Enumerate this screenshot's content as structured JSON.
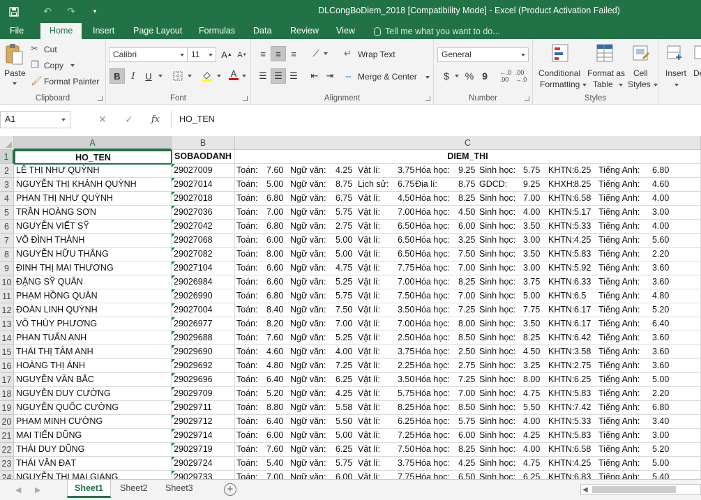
{
  "window": {
    "title": "DLCongBoDiem_2018  [Compatibility Mode] - Excel (Product Activation Failed)"
  },
  "qat": {
    "save_icon": "save-icon",
    "undo_icon": "undo-icon",
    "redo_icon": "redo-icon",
    "customize_icon": "customize-icon"
  },
  "tabs": [
    "File",
    "Home",
    "Insert",
    "Page Layout",
    "Formulas",
    "Data",
    "Review",
    "View"
  ],
  "tell_me": "Tell me what you want to do...",
  "ribbon": {
    "clipboard": {
      "label": "Clipboard",
      "paste": "Paste",
      "cut": "Cut",
      "copy": "Copy",
      "format_painter": "Format Painter"
    },
    "font": {
      "label": "Font",
      "name": "Calibri",
      "size": "11",
      "bold": "B",
      "italic": "I",
      "underline": "U"
    },
    "alignment": {
      "label": "Alignment",
      "wrap_text": "Wrap Text",
      "merge_center": "Merge & Center"
    },
    "number": {
      "label": "Number",
      "format": "General",
      "currency": "$",
      "percent": "%",
      "comma": "9"
    },
    "styles": {
      "label": "Styles",
      "conditional_1": "Conditional",
      "conditional_2": "Formatting",
      "format_table_1": "Format as",
      "format_table_2": "Table",
      "cell_styles_1": "Cell",
      "cell_styles_2": "Styles"
    },
    "cells": {
      "insert": "Insert",
      "delete_partial": "De"
    }
  },
  "formula_bar": {
    "name_box": "A1",
    "fx": "fx",
    "content": "HO_TEN"
  },
  "columns": [
    "A",
    "B",
    "C"
  ],
  "header_row": {
    "row": "1",
    "a": "HO_TEN",
    "b": "SOBAODANH",
    "c": "DIEM_THI"
  },
  "rows": [
    {
      "row": "2",
      "name": "LÊ THỊ NHƯ QUỲNH",
      "sbd": "29027009",
      "scores": [
        [
          "Toán:",
          "7.60"
        ],
        [
          "Ngữ văn:",
          "4.25"
        ],
        [
          "Vật lí:",
          "3.75"
        ],
        [
          "Hóa học:",
          "9.25"
        ],
        [
          "Sinh học:",
          "5.75"
        ],
        [
          "KHTN:",
          "6.25"
        ],
        [
          "Tiếng Anh:",
          "6.80"
        ]
      ]
    },
    {
      "row": "3",
      "name": "NGUYỄN THỊ KHÁNH QUỲNH",
      "sbd": "29027014",
      "scores": [
        [
          "Toán:",
          "5.00"
        ],
        [
          "Ngữ văn:",
          "8.75"
        ],
        [
          "Lịch sử:",
          "6.75"
        ],
        [
          "Địa lí:",
          "8.75"
        ],
        [
          "GDCD:",
          "9.25"
        ],
        [
          "KHXH:",
          "8.25"
        ],
        [
          "Tiếng Anh:",
          "4.60"
        ]
      ]
    },
    {
      "row": "4",
      "name": "PHAN THỊ NHƯ QUỲNH",
      "sbd": "29027018",
      "scores": [
        [
          "Toán:",
          "6.80"
        ],
        [
          "Ngữ văn:",
          "6.75"
        ],
        [
          "Vật lí:",
          "4.50"
        ],
        [
          "Hóa học:",
          "8.25"
        ],
        [
          "Sinh học:",
          "7.00"
        ],
        [
          "KHTN:",
          "6.58"
        ],
        [
          "Tiếng Anh:",
          "4.00"
        ]
      ]
    },
    {
      "row": "5",
      "name": "TRẦN HOÀNG SƠN",
      "sbd": "29027036",
      "scores": [
        [
          "Toán:",
          "7.00"
        ],
        [
          "Ngữ văn:",
          "5.75"
        ],
        [
          "Vật lí:",
          "7.00"
        ],
        [
          "Hóa học:",
          "4.50"
        ],
        [
          "Sinh học:",
          "4.00"
        ],
        [
          "KHTN:",
          "5.17"
        ],
        [
          "Tiếng Anh:",
          "3.00"
        ]
      ]
    },
    {
      "row": "6",
      "name": "NGUYỄN VIẾT SỸ",
      "sbd": "29027042",
      "scores": [
        [
          "Toán:",
          "6.80"
        ],
        [
          "Ngữ văn:",
          "2.75"
        ],
        [
          "Vật lí:",
          "6.50"
        ],
        [
          "Hóa học:",
          "6.00"
        ],
        [
          "Sinh học:",
          "3.50"
        ],
        [
          "KHTN:",
          "5.33"
        ],
        [
          "Tiếng Anh:",
          "4.00"
        ]
      ]
    },
    {
      "row": "7",
      "name": "VÕ ĐÌNH THÀNH",
      "sbd": "29027068",
      "scores": [
        [
          "Toán:",
          "6.00"
        ],
        [
          "Ngữ văn:",
          "5.00"
        ],
        [
          "Vật lí:",
          "6.50"
        ],
        [
          "Hóa học:",
          "3.25"
        ],
        [
          "Sinh học:",
          "3.00"
        ],
        [
          "KHTN:",
          "4.25"
        ],
        [
          "Tiếng Anh:",
          "5.60"
        ]
      ]
    },
    {
      "row": "8",
      "name": "NGUYỄN HỮU THẮNG",
      "sbd": "29027082",
      "scores": [
        [
          "Toán:",
          "8.00"
        ],
        [
          "Ngữ văn:",
          "5.00"
        ],
        [
          "Vật lí:",
          "6.50"
        ],
        [
          "Hóa học:",
          "7.50"
        ],
        [
          "Sinh học:",
          "3.50"
        ],
        [
          "KHTN:",
          "5.83"
        ],
        [
          "Tiếng Anh:",
          "2.20"
        ]
      ]
    },
    {
      "row": "9",
      "name": "ĐINH THỊ MAI THƯƠNG",
      "sbd": "29027104",
      "scores": [
        [
          "Toán:",
          "6.60"
        ],
        [
          "Ngữ văn:",
          "4.75"
        ],
        [
          "Vật lí:",
          "7.75"
        ],
        [
          "Hóa học:",
          "7.00"
        ],
        [
          "Sinh học:",
          "3.00"
        ],
        [
          "KHTN:",
          "5.92"
        ],
        [
          "Tiếng Anh:",
          "3.60"
        ]
      ]
    },
    {
      "row": "10",
      "name": "ĐẶNG SỸ QUÂN",
      "sbd": "29026984",
      "scores": [
        [
          "Toán:",
          "6.60"
        ],
        [
          "Ngữ văn:",
          "5.25"
        ],
        [
          "Vật lí:",
          "7.00"
        ],
        [
          "Hóa học:",
          "8.25"
        ],
        [
          "Sinh học:",
          "3.75"
        ],
        [
          "KHTN:",
          "6.33"
        ],
        [
          "Tiếng Anh:",
          "3.60"
        ]
      ]
    },
    {
      "row": "11",
      "name": "PHẠM HỒNG QUÂN",
      "sbd": "29026990",
      "scores": [
        [
          "Toán:",
          "6.80"
        ],
        [
          "Ngữ văn:",
          "5.75"
        ],
        [
          "Vật lí:",
          "7.50"
        ],
        [
          "Hóa học:",
          "7.00"
        ],
        [
          "Sinh học:",
          "5.00"
        ],
        [
          "KHTN:",
          "6.5"
        ],
        [
          "Tiếng Anh:",
          "4.80"
        ]
      ]
    },
    {
      "row": "12",
      "name": "ĐOÀN LINH QUỲNH",
      "sbd": "29027004",
      "scores": [
        [
          "Toán:",
          "8.40"
        ],
        [
          "Ngữ văn:",
          "7.50"
        ],
        [
          "Vật lí:",
          "3.50"
        ],
        [
          "Hóa học:",
          "7.25"
        ],
        [
          "Sinh học:",
          "7.75"
        ],
        [
          "KHTN:",
          "6.17"
        ],
        [
          "Tiếng Anh:",
          "5.20"
        ]
      ]
    },
    {
      "row": "13",
      "name": "VÕ THÙY PHƯƠNG",
      "sbd": "29026977",
      "scores": [
        [
          "Toán:",
          "8.20"
        ],
        [
          "Ngữ văn:",
          "7.00"
        ],
        [
          "Vật lí:",
          "7.00"
        ],
        [
          "Hóa học:",
          "8.00"
        ],
        [
          "Sinh học:",
          "3.50"
        ],
        [
          "KHTN:",
          "6.17"
        ],
        [
          "Tiếng Anh:",
          "6.40"
        ]
      ]
    },
    {
      "row": "14",
      "name": "PHAN TUẤN ANH",
      "sbd": "29029688",
      "scores": [
        [
          "Toán:",
          "7.60"
        ],
        [
          "Ngữ văn:",
          "5.25"
        ],
        [
          "Vật lí:",
          "2.50"
        ],
        [
          "Hóa học:",
          "8.50"
        ],
        [
          "Sinh học:",
          "8.25"
        ],
        [
          "KHTN:",
          "6.42"
        ],
        [
          "Tiếng Anh:",
          "3.60"
        ]
      ]
    },
    {
      "row": "15",
      "name": "THÁI THỊ TÂM ANH",
      "sbd": "29029690",
      "scores": [
        [
          "Toán:",
          "4.60"
        ],
        [
          "Ngữ văn:",
          "4.00"
        ],
        [
          "Vật lí:",
          "3.75"
        ],
        [
          "Hóa học:",
          "2.50"
        ],
        [
          "Sinh học:",
          "4.50"
        ],
        [
          "KHTN:",
          "3.58"
        ],
        [
          "Tiếng Anh:",
          "3.60"
        ]
      ]
    },
    {
      "row": "16",
      "name": "HOÀNG THỊ ÁNH",
      "sbd": "29029692",
      "scores": [
        [
          "Toán:",
          "4.80"
        ],
        [
          "Ngữ văn:",
          "7.25"
        ],
        [
          "Vật lí:",
          "2.25"
        ],
        [
          "Hóa học:",
          "2.75"
        ],
        [
          "Sinh học:",
          "3.25"
        ],
        [
          "KHTN:",
          "2.75"
        ],
        [
          "Tiếng Anh:",
          "3.60"
        ]
      ]
    },
    {
      "row": "17",
      "name": "NGUYỄN VĂN BẮC",
      "sbd": "29029696",
      "scores": [
        [
          "Toán:",
          "6.40"
        ],
        [
          "Ngữ văn:",
          "6.25"
        ],
        [
          "Vật lí:",
          "3.50"
        ],
        [
          "Hóa học:",
          "7.25"
        ],
        [
          "Sinh học:",
          "8.00"
        ],
        [
          "KHTN:",
          "6.25"
        ],
        [
          "Tiếng Anh:",
          "5.00"
        ]
      ]
    },
    {
      "row": "18",
      "name": "NGUYỄN DUY CƯỜNG",
      "sbd": "29029709",
      "scores": [
        [
          "Toán:",
          "5.20"
        ],
        [
          "Ngữ văn:",
          "4.25"
        ],
        [
          "Vật lí:",
          "5.75"
        ],
        [
          "Hóa học:",
          "7.00"
        ],
        [
          "Sinh học:",
          "4.75"
        ],
        [
          "KHTN:",
          "5.83"
        ],
        [
          "Tiếng Anh:",
          "2.20"
        ]
      ]
    },
    {
      "row": "19",
      "name": "NGUYỄN QUỐC CƯỜNG",
      "sbd": "29029711",
      "scores": [
        [
          "Toán:",
          "8.80"
        ],
        [
          "Ngữ văn:",
          "5.58"
        ],
        [
          "Vật lí:",
          "8.25"
        ],
        [
          "Hóa học:",
          "8.50"
        ],
        [
          "Sinh học:",
          "5.50"
        ],
        [
          "KHTN:",
          "7.42"
        ],
        [
          "Tiếng Anh:",
          "6.80"
        ]
      ]
    },
    {
      "row": "20",
      "name": "PHẠM MINH CƯỜNG",
      "sbd": "29029712",
      "scores": [
        [
          "Toán:",
          "6.40"
        ],
        [
          "Ngữ văn:",
          "5.50"
        ],
        [
          "Vật lí:",
          "6.25"
        ],
        [
          "Hóa học:",
          "5.75"
        ],
        [
          "Sinh học:",
          "4.00"
        ],
        [
          "KHTN:",
          "5.33"
        ],
        [
          "Tiếng Anh:",
          "3.40"
        ]
      ]
    },
    {
      "row": "21",
      "name": "MAI TIẾN DŨNG",
      "sbd": "29029714",
      "scores": [
        [
          "Toán:",
          "6.00"
        ],
        [
          "Ngữ văn:",
          "5.00"
        ],
        [
          "Vật lí:",
          "7.25"
        ],
        [
          "Hóa học:",
          "6.00"
        ],
        [
          "Sinh học:",
          "4.25"
        ],
        [
          "KHTN:",
          "5.83"
        ],
        [
          "Tiếng Anh:",
          "3.00"
        ]
      ]
    },
    {
      "row": "22",
      "name": "THÁI DUY DŨNG",
      "sbd": "29029719",
      "scores": [
        [
          "Toán:",
          "7.60"
        ],
        [
          "Ngữ văn:",
          "6.25"
        ],
        [
          "Vật lí:",
          "7.50"
        ],
        [
          "Hóa học:",
          "8.25"
        ],
        [
          "Sinh học:",
          "4.00"
        ],
        [
          "KHTN:",
          "6.58"
        ],
        [
          "Tiếng Anh:",
          "5.20"
        ]
      ]
    },
    {
      "row": "23",
      "name": "THÁI VĂN ĐẠT",
      "sbd": "29029724",
      "scores": [
        [
          "Toán:",
          "5.40"
        ],
        [
          "Ngữ văn:",
          "5.75"
        ],
        [
          "Vật lí:",
          "3.75"
        ],
        [
          "Hóa học:",
          "4.25"
        ],
        [
          "Sinh học:",
          "4.75"
        ],
        [
          "KHTN:",
          "4.25"
        ],
        [
          "Tiếng Anh:",
          "5.00"
        ]
      ]
    },
    {
      "row": "24",
      "name": "NGUYỄN THỊ MAI GIANG",
      "sbd": "29029733",
      "scores": [
        [
          "Toán:",
          "7.00"
        ],
        [
          "Ngữ văn:",
          "6.00"
        ],
        [
          "Vật lí:",
          "7.75"
        ],
        [
          "Hóa học:",
          "6.50"
        ],
        [
          "Sinh học:",
          "6.25"
        ],
        [
          "KHTN:",
          "6.83"
        ],
        [
          "Tiếng Anh:",
          "5.40"
        ]
      ]
    }
  ],
  "sheets": [
    "Sheet1",
    "Sheet2",
    "Sheet3"
  ],
  "colors": {
    "accent": "#217346",
    "ribbon_bg": "#f3f3f3",
    "header_bg": "#e6e6e6"
  }
}
